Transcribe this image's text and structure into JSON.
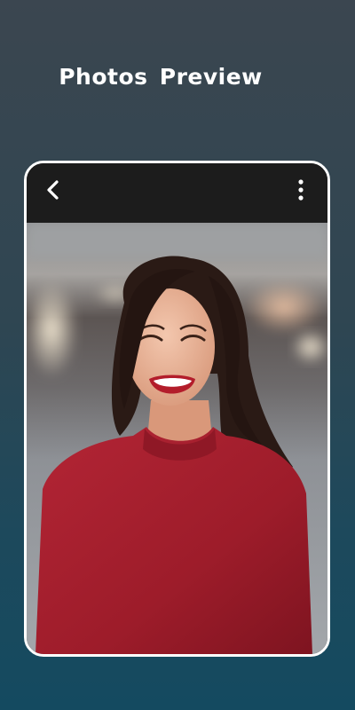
{
  "headline": "Photos  Preview",
  "viewer": {
    "back_icon": "chevron-left-icon",
    "more_icon": "more-vertical-icon",
    "photo": {
      "subject": "portrait-photo",
      "colors": {
        "sweater": "#a51d2c",
        "hair": "#2a1a15",
        "skin": "#e9b398",
        "background": "#9a9b9e"
      }
    }
  }
}
